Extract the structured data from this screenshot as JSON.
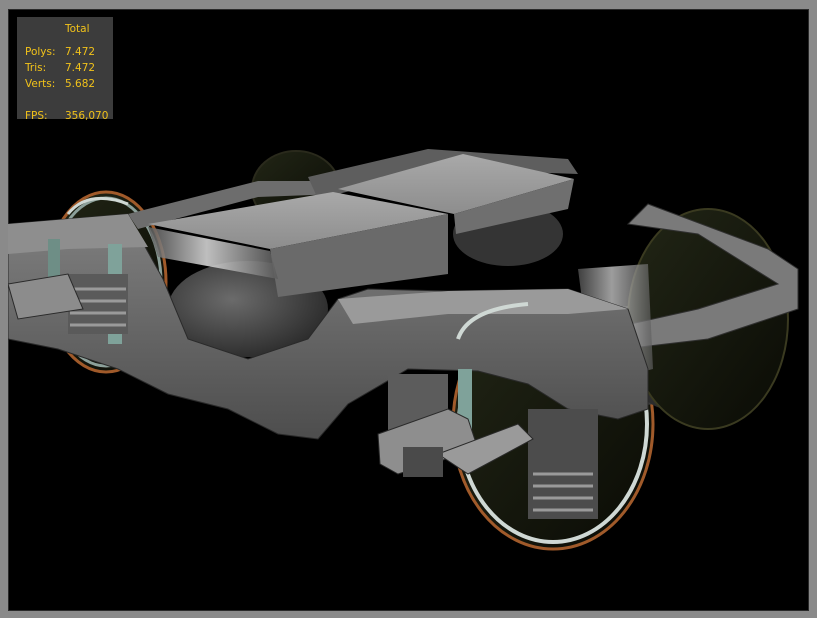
{
  "viewport": {
    "background": "#000000",
    "subject": "train bogie 3d model"
  },
  "stats": {
    "header": "Total",
    "rows": [
      {
        "label": "Polys:",
        "value": "7.472"
      },
      {
        "label": "Tris:",
        "value": "7.472"
      },
      {
        "label": "Verts:",
        "value": "5.682"
      },
      {
        "label": "FPS:",
        "value": "356,070"
      }
    ],
    "text_color": "#f1c21a"
  }
}
